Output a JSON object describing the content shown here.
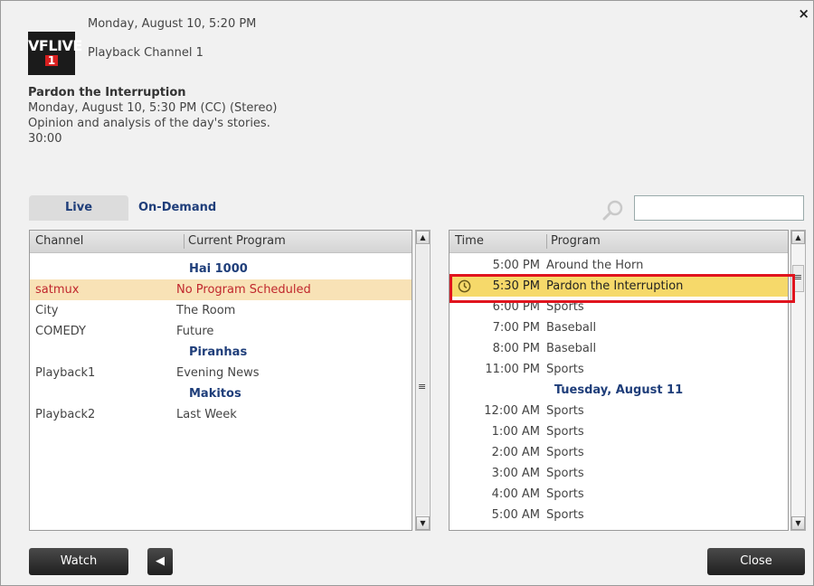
{
  "header": {
    "close_glyph": "×",
    "datetime": "Monday, August 10, 5:20 PM",
    "channel": "Playback Channel 1",
    "logo_line1": "VFLIVE",
    "logo_line2": "1"
  },
  "program": {
    "title": "Pardon the Interruption",
    "airtime": "Monday, August 10, 5:30 PM (CC) (Stereo)",
    "description": "Opinion and analysis of the day's stories.",
    "duration": "30:00"
  },
  "tabs": {
    "live": "Live",
    "ondemand": "On-Demand"
  },
  "search": {
    "value": "",
    "icon": "search-icon"
  },
  "channels": {
    "col_channel": "Channel",
    "col_program": "Current Program",
    "rows": [
      {
        "channel": "",
        "program": "Hai 1000",
        "type": "group"
      },
      {
        "channel": "satmux",
        "program": "No Program Scheduled",
        "type": "selected"
      },
      {
        "channel": "City",
        "program": "The Room",
        "type": "item"
      },
      {
        "channel": "COMEDY",
        "program": "Future",
        "type": "item"
      },
      {
        "channel": "",
        "program": "Piranhas",
        "type": "group"
      },
      {
        "channel": "Playback1",
        "program": "Evening News",
        "type": "item"
      },
      {
        "channel": "",
        "program": "Makitos",
        "type": "group"
      },
      {
        "channel": "Playback2",
        "program": "Last Week",
        "type": "item"
      }
    ]
  },
  "schedule": {
    "col_time": "Time",
    "col_program": "Program",
    "rows": [
      {
        "time": "5:00 PM",
        "program": "Around the Horn",
        "type": "item"
      },
      {
        "time": "5:30 PM",
        "program": "Pardon the Interruption",
        "type": "selected"
      },
      {
        "time": "6:00 PM",
        "program": "Sports",
        "type": "item"
      },
      {
        "time": "7:00 PM",
        "program": "Baseball",
        "type": "item"
      },
      {
        "time": "8:00 PM",
        "program": "Baseball",
        "type": "item"
      },
      {
        "time": "11:00 PM",
        "program": "Sports",
        "type": "item"
      },
      {
        "time": "",
        "program": "Tuesday, August 11",
        "type": "group"
      },
      {
        "time": "12:00 AM",
        "program": "Sports",
        "type": "item"
      },
      {
        "time": "1:00 AM",
        "program": "Sports",
        "type": "item"
      },
      {
        "time": "2:00 AM",
        "program": "Sports",
        "type": "item"
      },
      {
        "time": "3:00 AM",
        "program": "Sports",
        "type": "item"
      },
      {
        "time": "4:00 AM",
        "program": "Sports",
        "type": "item"
      },
      {
        "time": "5:00 AM",
        "program": "Sports",
        "type": "item"
      }
    ]
  },
  "buttons": {
    "watch": "Watch",
    "back_glyph": "◀",
    "close": "Close"
  },
  "colors": {
    "accent_blue": "#1f3e7a",
    "selected_channel_bg": "#f8e2b6",
    "selected_channel_text": "#c0272d",
    "selected_schedule_bg": "#f6d96a",
    "highlight_border": "#e0141e"
  }
}
